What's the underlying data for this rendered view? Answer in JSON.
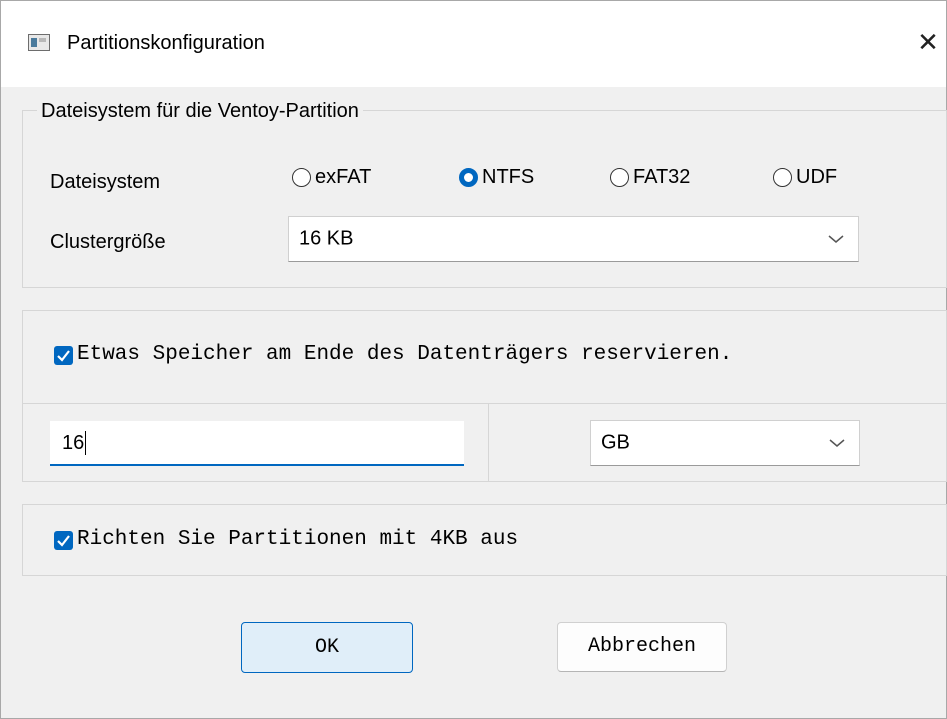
{
  "window": {
    "title": "Partitionskonfiguration"
  },
  "fs_group": {
    "title": "Dateisystem für die Ventoy-Partition",
    "fs_label": "Dateisystem",
    "cluster_label": "Clustergröße",
    "options": [
      {
        "label": "exFAT",
        "checked": false
      },
      {
        "label": "NTFS",
        "checked": true
      },
      {
        "label": "FAT32",
        "checked": false
      },
      {
        "label": "UDF",
        "checked": false
      }
    ],
    "cluster_value": "16 KB"
  },
  "reserve": {
    "label": "Etwas Speicher am Ende des Datenträgers reservieren.",
    "checked": true,
    "amount": "16",
    "unit": "GB"
  },
  "align": {
    "label": "Richten Sie Partitionen mit 4KB aus",
    "checked": true
  },
  "buttons": {
    "ok": "OK",
    "cancel": "Abbrechen"
  },
  "colors": {
    "accent": "#0067c0",
    "ok_bg": "#e0eef9"
  }
}
